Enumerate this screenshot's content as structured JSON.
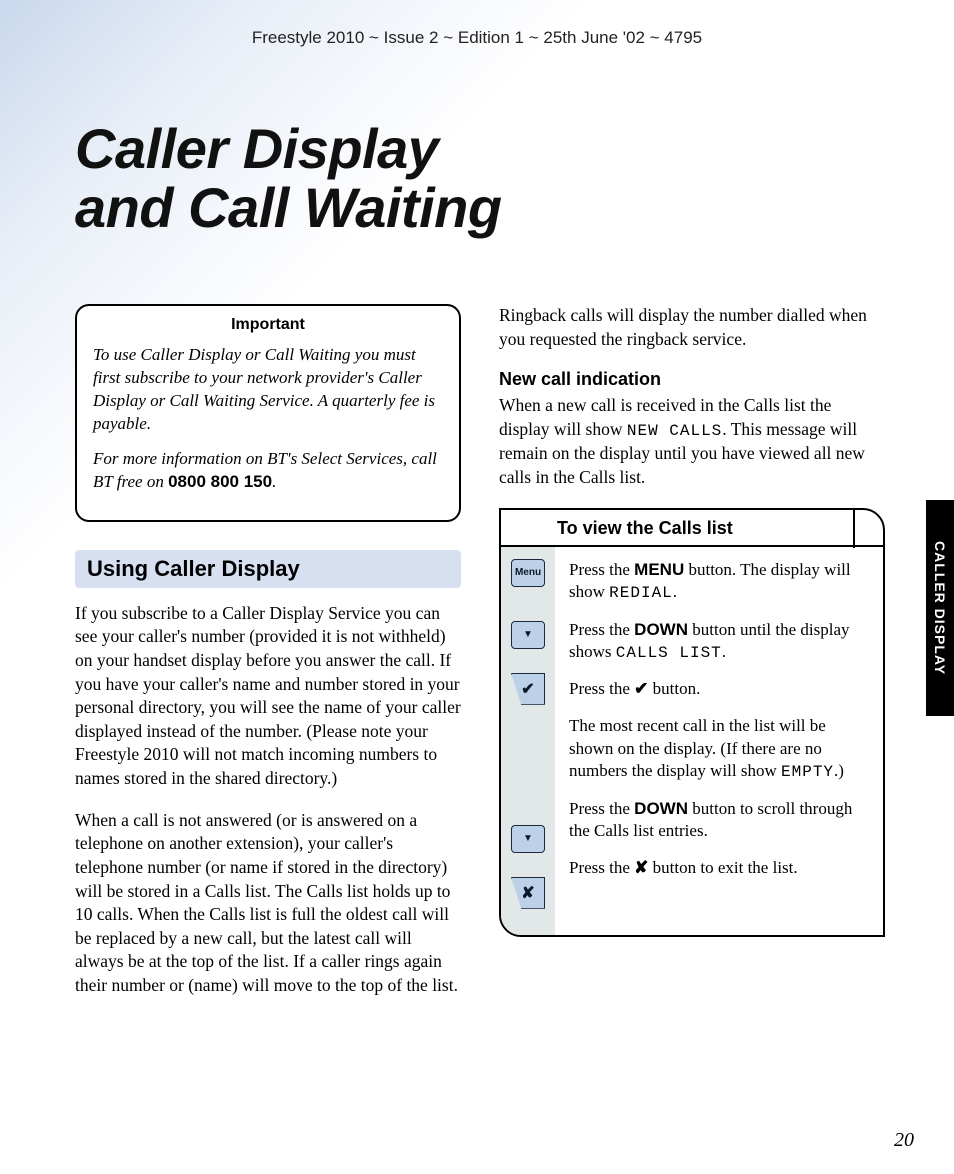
{
  "header": "Freestyle 2010 ~ Issue 2 ~ Edition 1 ~ 25th June '02 ~ 4795",
  "title_line1": "Caller Display",
  "title_line2": "and Call Waiting",
  "important": {
    "label": "Important",
    "p1": "To use Caller Display or Call Waiting you must first subscribe to your network provider's Caller Display or Call Waiting Service. A quarterly fee is payable.",
    "p2a": "For more information on BT's Select Services, call BT free on ",
    "phone": "0800 800 150",
    "p2b": "."
  },
  "section_head": "Using Caller Display",
  "col1_p1": "If you subscribe to a Caller Display Service you can see your caller's number (provided it is not withheld) on your handset display before you answer the call. If you have your caller's name and number stored in your personal directory, you will see the name of your caller displayed instead of the number. (Please note your Freestyle 2010 will not match incoming numbers to names stored in the shared directory.)",
  "col1_p2": "When a call is not answered (or is answered on a telephone on another extension), your caller's telephone number (or name if stored in the directory) will be stored in a Calls list. The Calls list holds up to 10 calls. When the Calls list is full the oldest call will be replaced by a new call, but the latest call will always be at the top of the list. If a caller rings again their number or (name) will move to the top of the list.",
  "col2_p1": "Ringback calls will display the number dialled when you requested the ringback service.",
  "subhead": "New call indication",
  "col2_p2a": "When a new call is received in the Calls list the display will show ",
  "col2_p2_lcd": "NEW CALLS",
  "col2_p2b": ". This message will remain on the display until you have viewed all new calls in the Calls list.",
  "proc": {
    "title": "To view the Calls list",
    "step1a": "Press the ",
    "step1_btn": "MENU",
    "step1b": " button.   The display will show ",
    "step1_lcd": "REDIAL",
    "step1c": ".",
    "step2a": "Press the ",
    "step2_btn": "DOWN",
    "step2b": " button until the display shows ",
    "step2_lcd": "CALLS LIST",
    "step2c": ".",
    "step3a": "Press the ",
    "step3_icon": "✔",
    "step3b": " button.",
    "step4a": "The most recent call in the list will be shown on the display. (If there are no numbers the display will show ",
    "step4_lcd": "EMPTY",
    "step4b": ".)",
    "step5a": "Press the ",
    "step5_btn": "DOWN",
    "step5b": " button to scroll through the Calls list entries.",
    "step6a": "Press the ",
    "step6_icon": "✘",
    "step6b": " button to exit the list."
  },
  "keys": {
    "menu": "Menu",
    "down": "▼",
    "check": "✔",
    "cross": "✘"
  },
  "side_tab": "CALLER DISPLAY",
  "page_number": "20"
}
